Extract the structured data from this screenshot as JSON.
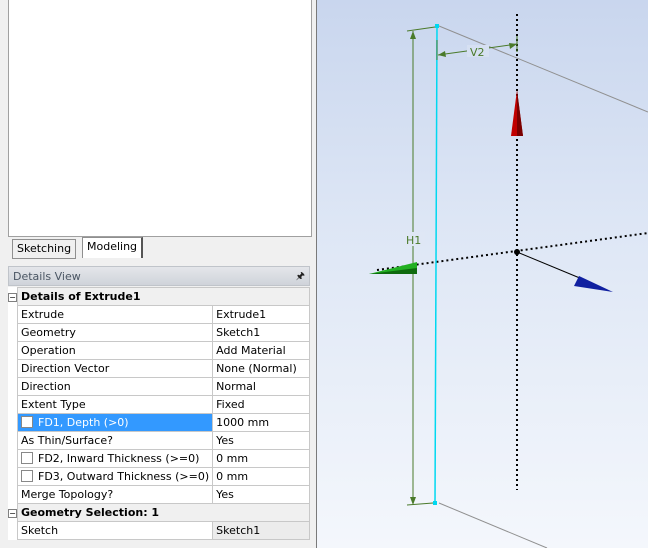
{
  "tabs": {
    "sketching": "Sketching",
    "modeling": "Modeling"
  },
  "details": {
    "title": "Details View",
    "pin_icon": "pin-icon",
    "group1": "Details of Extrude1",
    "rows1": [
      {
        "label": "Extrude",
        "value": "Extrude1"
      },
      {
        "label": "Geometry",
        "value": "Sketch1"
      },
      {
        "label": "Operation",
        "value": "Add Material"
      },
      {
        "label": "Direction Vector",
        "value": "None (Normal)"
      },
      {
        "label": "Direction",
        "value": "Normal"
      },
      {
        "label": "Extent Type",
        "value": "Fixed"
      },
      {
        "label": "FD1,  Depth (>0)",
        "value": "1000 mm",
        "checkbox": true,
        "selected": true
      },
      {
        "label": "As Thin/Surface?",
        "value": "Yes"
      },
      {
        "label": "FD2,  Inward Thickness (>=0)",
        "value": "0 mm",
        "checkbox": true
      },
      {
        "label": "FD3,  Outward Thickness (>=0)",
        "value": "0 mm",
        "checkbox": true
      },
      {
        "label": "Merge Topology?",
        "value": "Yes"
      }
    ],
    "group2": "Geometry Selection: 1",
    "rows2": [
      {
        "label": "Sketch",
        "value": "Sketch1"
      }
    ]
  },
  "viewport": {
    "dim_h": "H1",
    "dim_v": "V2",
    "colors": {
      "line": "#00d8f0",
      "dim": "#4a7a2a",
      "red": "#c00000",
      "green": "#22b022",
      "blue": "#1020a0"
    }
  }
}
